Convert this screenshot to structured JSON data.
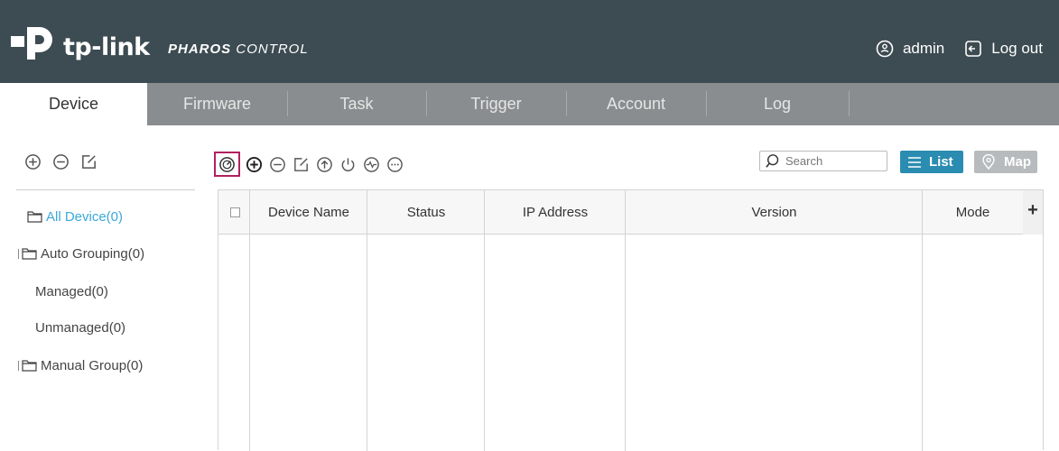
{
  "header": {
    "brand": "tp-link",
    "product_bold": "PHAROS",
    "product_light": " CONTROL",
    "user": "admin",
    "logout": "Log out"
  },
  "tabs": [
    {
      "label": "Device",
      "active": true
    },
    {
      "label": "Firmware",
      "active": false
    },
    {
      "label": "Task",
      "active": false
    },
    {
      "label": "Trigger",
      "active": false
    },
    {
      "label": "Account",
      "active": false
    },
    {
      "label": "Log",
      "active": false
    }
  ],
  "left_panel": {
    "tools": [
      "add-icon",
      "remove-icon",
      "edit-icon"
    ],
    "tree": [
      {
        "label": "All Device(0)",
        "selected": true
      },
      {
        "label": "Auto Grouping(0)"
      },
      {
        "label": "Managed(0)"
      },
      {
        "label": "Unmanaged(0)"
      },
      {
        "label": "Manual Group(0)"
      }
    ]
  },
  "toolbar": {
    "icons": [
      "discover-icon",
      "add-icon",
      "remove-icon",
      "edit-icon",
      "upgrade-icon",
      "power-icon",
      "monitor-icon",
      "more-icon"
    ],
    "search_placeholder": "Search",
    "list_label": "List",
    "map_label": "Map"
  },
  "table": {
    "columns": [
      "Device Name",
      "Status",
      "IP Address",
      "Version",
      "Mode"
    ],
    "add_column": "+"
  },
  "colors": {
    "header_bg": "#3d4b52",
    "tab_bar_bg": "#8a8d8f",
    "accent": "#2a8cb0",
    "selected_text": "#3aa8d8",
    "highlight_box": "#b12060"
  }
}
